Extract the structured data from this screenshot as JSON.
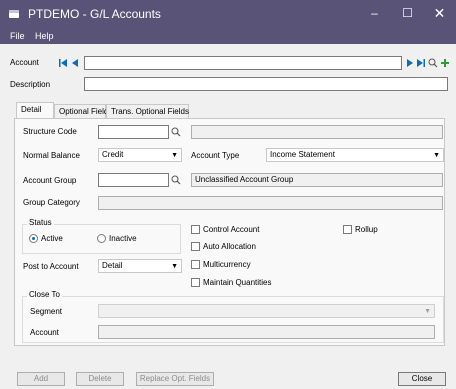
{
  "window": {
    "title": "PTDEMO - G/L Accounts"
  },
  "menu": {
    "file": "File",
    "help": "Help"
  },
  "header": {
    "account_label": "Account",
    "account_value": "",
    "description_label": "Description",
    "description_value": ""
  },
  "tabs": [
    {
      "label": "Detail"
    },
    {
      "label": "Optional Fields"
    },
    {
      "label": "Trans. Optional Fields"
    }
  ],
  "detail": {
    "structure_code_label": "Structure Code",
    "structure_code_value": "",
    "structure_desc_value": "",
    "normal_balance_label": "Normal Balance",
    "normal_balance_value": "Credit",
    "account_type_label": "Account Type",
    "account_type_value": "Income Statement",
    "account_group_label": "Account Group",
    "account_group_value": "",
    "account_group_desc": "Unclassified Account Group",
    "group_category_label": "Group Category",
    "group_category_value": "",
    "status_label": "Status",
    "status_active": "Active",
    "status_inactive": "Inactive",
    "control_account": "Control Account",
    "rollup": "Rollup",
    "auto_allocation": "Auto Allocation",
    "multicurrency": "Multicurrency",
    "maintain_quantities": "Maintain Quantities",
    "post_to_account_label": "Post to Account",
    "post_to_account_value": "Detail",
    "close_to_label": "Close To",
    "segment_label": "Segment",
    "segment_value": "",
    "close_account_label": "Account",
    "close_account_value": ""
  },
  "buttons": {
    "add": "Add",
    "delete": "Delete",
    "replace": "Replace Opt. Fields",
    "close": "Close"
  },
  "colors": {
    "titlebar": "#5a5378",
    "accent": "#0b6db7",
    "add_icon": "#2e9b3a"
  }
}
